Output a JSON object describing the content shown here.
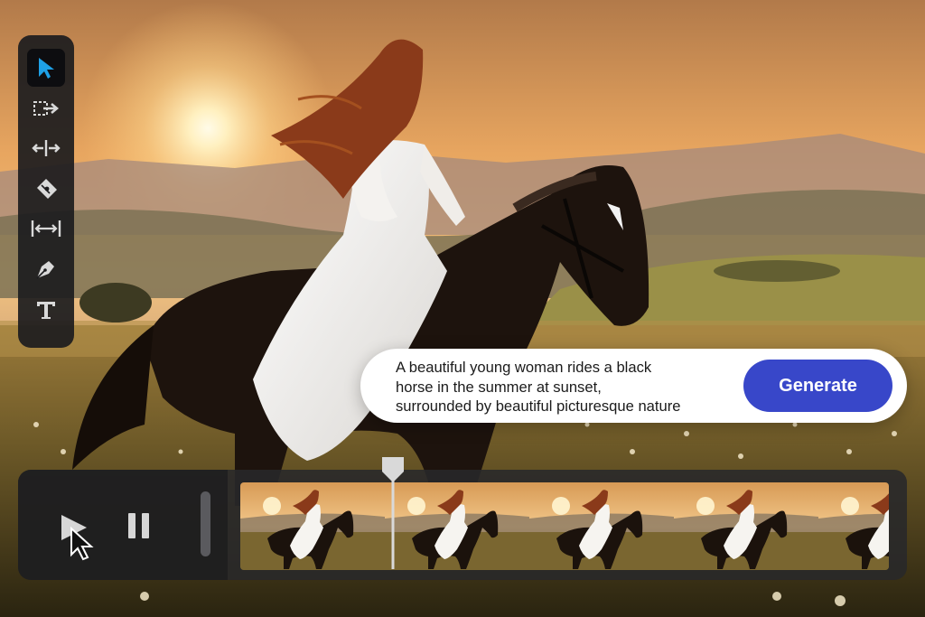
{
  "toolbar": {
    "tools": [
      {
        "name": "selection-tool",
        "icon": "pointer-arrow-icon",
        "active": true
      },
      {
        "name": "track-select-tool",
        "icon": "track-select-forward-icon",
        "active": false
      },
      {
        "name": "ripple-edit-tool",
        "icon": "ripple-edit-icon",
        "active": false
      },
      {
        "name": "razor-tool",
        "icon": "razor-blade-icon",
        "active": false
      },
      {
        "name": "slip-tool",
        "icon": "slip-icon",
        "active": false
      },
      {
        "name": "pen-tool",
        "icon": "pen-nib-icon",
        "active": false
      },
      {
        "name": "type-tool",
        "icon": "type-t-icon",
        "active": false
      }
    ]
  },
  "prompt": {
    "line1": "A beautiful young woman rides a black",
    "line2": "horse in the summer at sunset,",
    "line3": "surrounded by beautiful picturesque nature",
    "button_label": "Generate"
  },
  "timeline": {
    "controls": {
      "play_icon": "play-icon",
      "pause_icon": "pause-icon"
    },
    "frame_count": 5
  },
  "colors": {
    "accent": "#3847c9",
    "tool_active": "#1ea0e6",
    "panel": "#1c1c1e"
  }
}
